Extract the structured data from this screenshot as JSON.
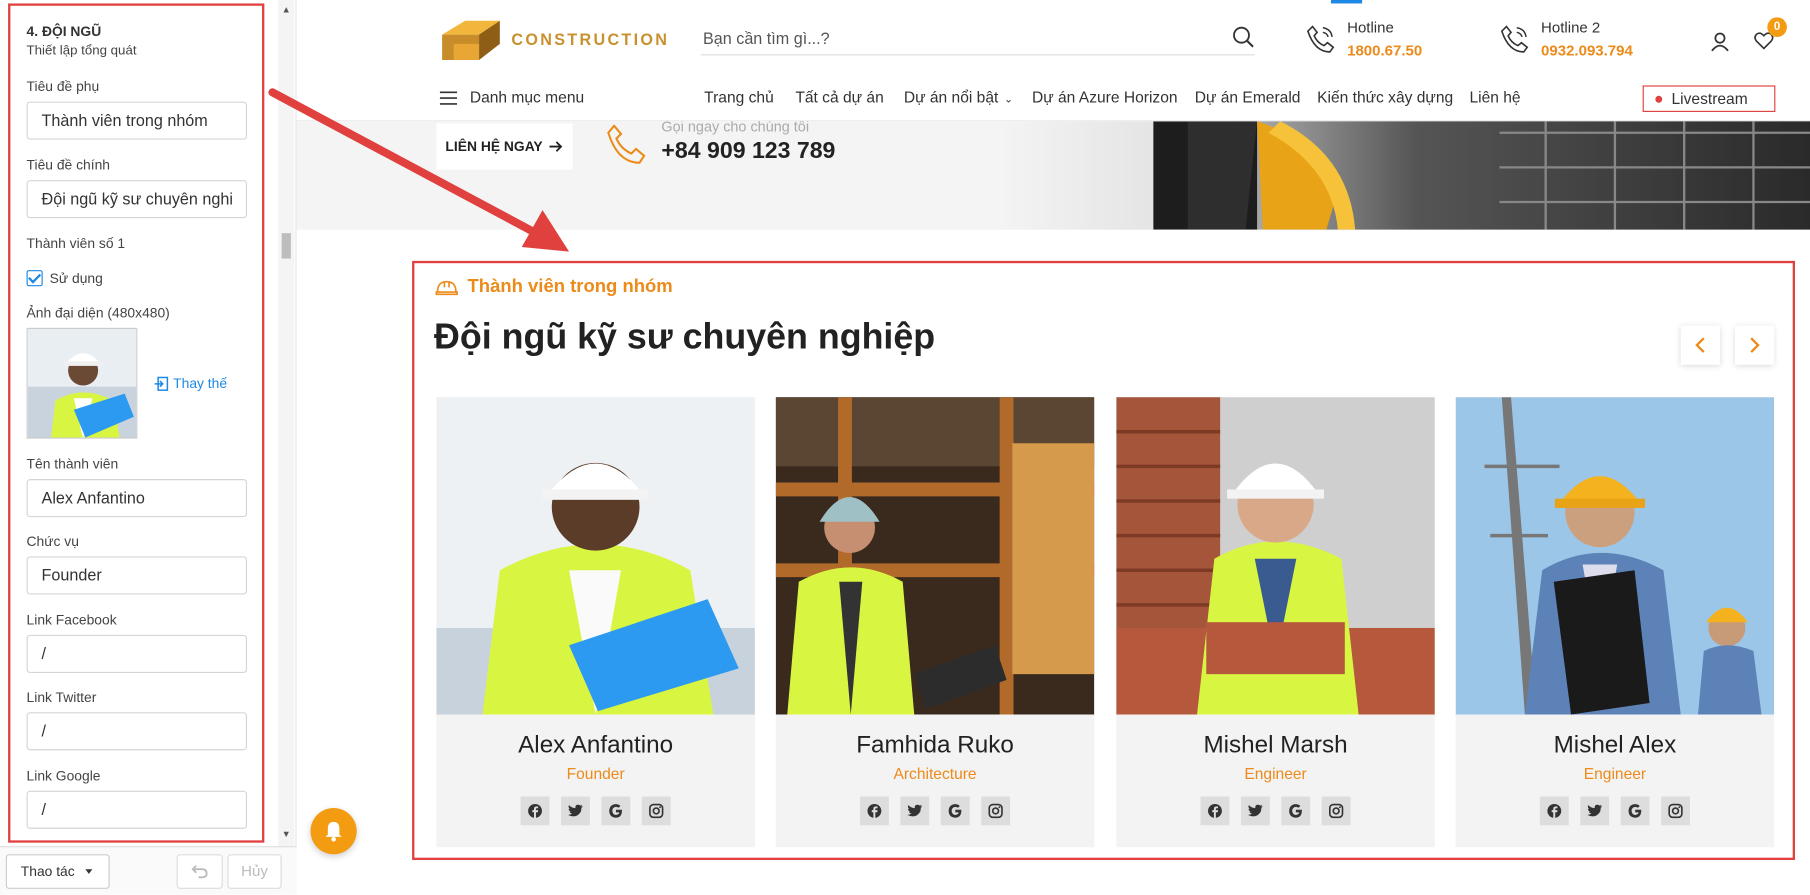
{
  "panel": {
    "section_title": "4. ĐỘI NGŨ",
    "section_subtitle": "Thiết lập tổng quát",
    "subtitle_label": "Tiêu đề phụ",
    "subtitle_value": "Thành viên trong nhóm",
    "main_title_label": "Tiêu đề chính",
    "main_title_value": "Đội ngũ kỹ sư chuyên nghi",
    "member_label": "Thành viên số 1",
    "use_checkbox_label": "Sử dụng",
    "avatar_label": "Ảnh đại diện (480x480)",
    "replace_label": "Thay thế",
    "name_label": "Tên thành viên",
    "name_value": "Alex Anfantino",
    "position_label": "Chức vụ",
    "position_value": "Founder",
    "facebook_label": "Link Facebook",
    "facebook_value": "/",
    "twitter_label": "Link Twitter",
    "twitter_value": "/",
    "google_label": "Link Google",
    "google_value": "/",
    "action_label": "Thao tác",
    "cancel_label": "Hủy"
  },
  "header": {
    "logo_text": "CONSTRUCTION",
    "search_placeholder": "Bạn cần tìm gì...?",
    "hotline1_label": "Hotline",
    "hotline1_number": "1800.67.50",
    "hotline2_label": "Hotline 2",
    "hotline2_number": "0932.093.794",
    "cart_count": "0",
    "menu_label": "Danh mục menu",
    "nav": [
      "Trang chủ",
      "Tất cả dự án",
      "Dự án nổi bật",
      "Dự án Azure Horizon",
      "Dự án Emerald",
      "Kiến thức xây dựng",
      "Liên hệ"
    ],
    "livestream_label": "Livestream"
  },
  "banner": {
    "contact_btn": "LIÊN HỆ NGAY",
    "call_label": "Gọi ngay cho chúng tôi",
    "call_number": "+84 909 123 789"
  },
  "team": {
    "subtitle": "Thành viên trong nhóm",
    "title": "Đội ngũ kỹ sư chuyên nghiệp",
    "members": [
      {
        "name": "Alex Anfantino",
        "role": "Founder"
      },
      {
        "name": "Famhida Ruko",
        "role": "Architecture"
      },
      {
        "name": "Mishel Marsh",
        "role": "Engineer"
      },
      {
        "name": "Mishel Alex",
        "role": "Engineer"
      }
    ]
  },
  "colors": {
    "accent": "#ec8a1a",
    "highlight_frame": "#e0403e",
    "link_blue": "#1e88e5"
  }
}
